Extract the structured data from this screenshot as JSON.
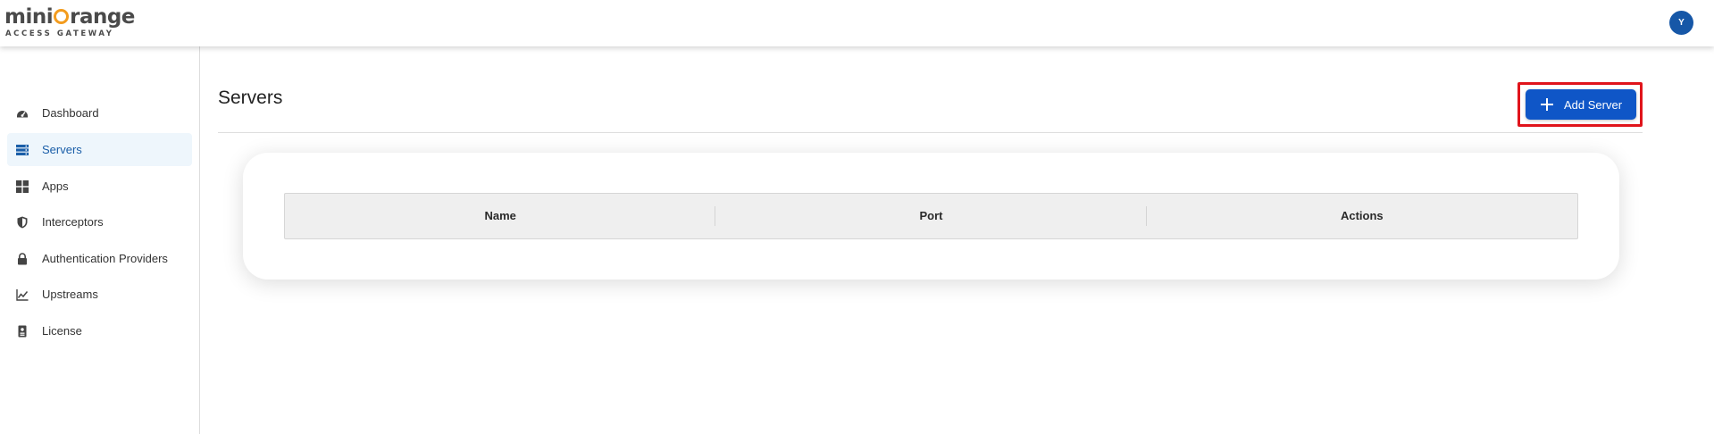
{
  "brand": {
    "logo_text_start": "mini",
    "logo_text_end": "range",
    "logo_subtitle": "ACCESS GATEWAY"
  },
  "user": {
    "avatar_initial": "Y",
    "avatar_color": "#1657a7"
  },
  "sidebar": {
    "items": [
      {
        "label": "Dashboard",
        "icon": "dashboard-icon",
        "active": false
      },
      {
        "label": "Servers",
        "icon": "servers-icon",
        "active": true
      },
      {
        "label": "Apps",
        "icon": "apps-icon",
        "active": false
      },
      {
        "label": "Interceptors",
        "icon": "shield-icon",
        "active": false
      },
      {
        "label": "Authentication Providers",
        "icon": "lock-icon",
        "active": false
      },
      {
        "label": "Upstreams",
        "icon": "chart-line-icon",
        "active": false
      },
      {
        "label": "License",
        "icon": "license-icon",
        "active": false
      }
    ]
  },
  "main": {
    "title": "Servers",
    "add_button_label": "Add Server",
    "add_button_icon": "plus-icon",
    "accent_color": "#0f56c7",
    "highlight_color": "#e0141b"
  },
  "table": {
    "columns": [
      "Name",
      "Port",
      "Actions"
    ],
    "rows": []
  }
}
